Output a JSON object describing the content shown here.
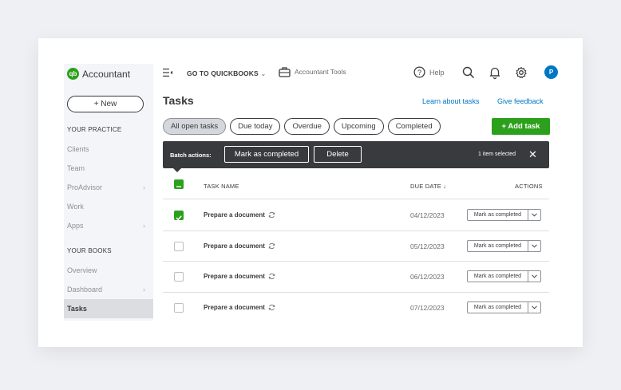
{
  "app": {
    "name": "Accountant",
    "logo_mark": "qb"
  },
  "sidebar": {
    "new_button": "+ New",
    "section_practice": "YOUR PRACTICE",
    "practice_items": [
      {
        "label": "Clients"
      },
      {
        "label": "Team"
      },
      {
        "label": "ProAdvisor",
        "chevron": "›"
      },
      {
        "label": "Work"
      },
      {
        "label": "Apps",
        "chevron": "›"
      }
    ],
    "section_books": "YOUR BOOKS",
    "book_items": [
      {
        "label": "Overview"
      },
      {
        "label": "Dashboard",
        "chevron": "›"
      },
      {
        "label": "Tasks"
      }
    ]
  },
  "topbar": {
    "goto": "GO TO QUICKBOOKS",
    "goto_caret": "⌄",
    "accountant_tools": "Accountant Tools",
    "help": "Help",
    "avatar_initial": "P"
  },
  "page": {
    "title": "Tasks",
    "learn_link": "Learn about tasks",
    "feedback_link": "Give feedback",
    "add_task": "+ Add task"
  },
  "filters": [
    {
      "label": "All open tasks",
      "selected": true
    },
    {
      "label": "Due today",
      "selected": false
    },
    {
      "label": "Overdue",
      "selected": false
    },
    {
      "label": "Upcoming",
      "selected": false
    },
    {
      "label": "Completed",
      "selected": false
    }
  ],
  "batch": {
    "label": "Batch actions:",
    "mark_completed": "Mark as completed",
    "delete": "Delete",
    "selected_count": "1 item selected",
    "close": "✕"
  },
  "table": {
    "col_task": "TASK NAME",
    "col_due": "DUE DATE ↓",
    "col_actions": "ACTIONS",
    "rows": [
      {
        "name": "Prepare a document",
        "due": "04/12/2023",
        "action": "Mark as completed",
        "checked": true
      },
      {
        "name": "Prepare a document",
        "due": "05/12/2023",
        "action": "Mark as completed",
        "checked": false
      },
      {
        "name": "Prepare a document",
        "due": "06/12/2023",
        "action": "Mark as completed",
        "checked": false
      },
      {
        "name": "Prepare a document",
        "due": "07/12/2023",
        "action": "Mark as completed",
        "checked": false
      }
    ]
  },
  "colors": {
    "brand_green": "#2ca01c",
    "link_blue": "#0077c5",
    "dark": "#393a3d"
  }
}
